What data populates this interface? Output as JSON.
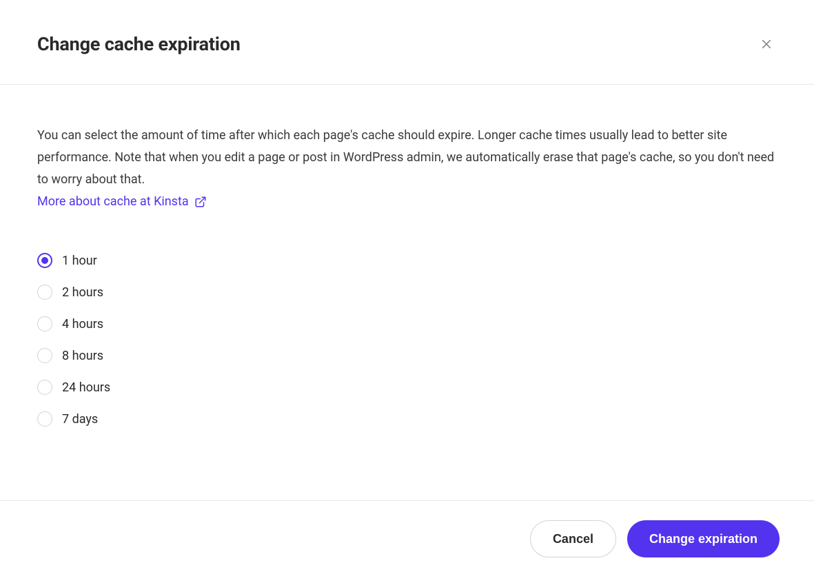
{
  "modal": {
    "title": "Change cache expiration",
    "description": "You can select the amount of time after which each page's cache should expire. Longer cache times usually lead to better site performance. Note that when you edit a page or post in WordPress admin, we automatically erase that page's cache, so you don't need to worry about that.",
    "more_link_text": "More about cache at Kinsta",
    "options": [
      {
        "label": "1 hour",
        "selected": true
      },
      {
        "label": "2 hours",
        "selected": false
      },
      {
        "label": "4 hours",
        "selected": false
      },
      {
        "label": "8 hours",
        "selected": false
      },
      {
        "label": "24 hours",
        "selected": false
      },
      {
        "label": "7 days",
        "selected": false
      }
    ],
    "cancel_label": "Cancel",
    "submit_label": "Change expiration"
  },
  "colors": {
    "accent": "#5333ed",
    "border": "#e9e9ec",
    "text": "#2a2a2a"
  }
}
